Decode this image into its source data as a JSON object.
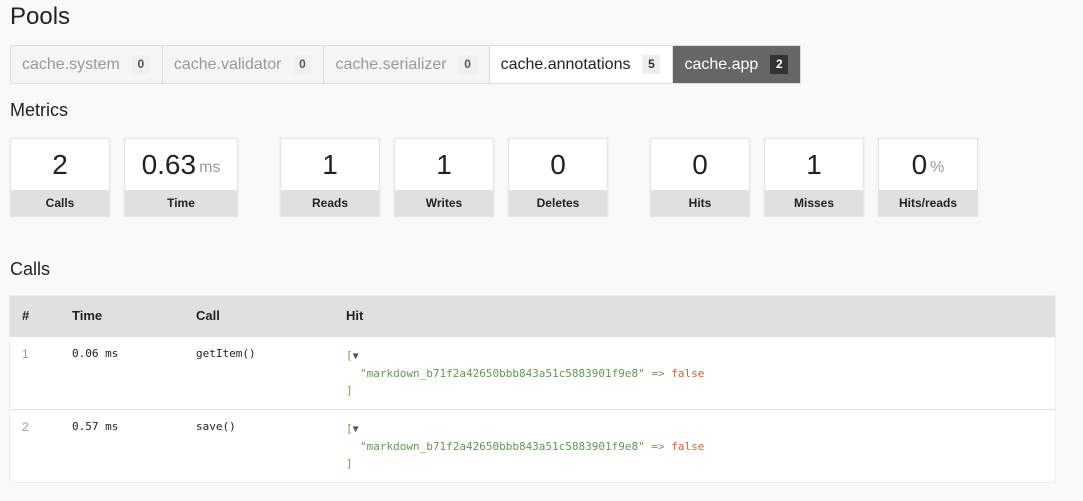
{
  "pools": {
    "title": "Pools",
    "tabs": [
      {
        "label": "cache.system",
        "count": "0",
        "state": "empty"
      },
      {
        "label": "cache.validator",
        "count": "0",
        "state": "empty"
      },
      {
        "label": "cache.serializer",
        "count": "0",
        "state": "empty"
      },
      {
        "label": "cache.annotations",
        "count": "5",
        "state": "has-items"
      },
      {
        "label": "cache.app",
        "count": "2",
        "state": "active"
      }
    ]
  },
  "metrics": {
    "title": "Metrics",
    "items": [
      {
        "value": "2",
        "unit": "",
        "label": "Calls"
      },
      {
        "value": "0.63",
        "unit": "ms",
        "label": "Time"
      },
      {
        "value": "1",
        "unit": "",
        "label": "Reads"
      },
      {
        "value": "1",
        "unit": "",
        "label": "Writes"
      },
      {
        "value": "0",
        "unit": "",
        "label": "Deletes"
      },
      {
        "value": "0",
        "unit": "",
        "label": "Hits"
      },
      {
        "value": "1",
        "unit": "",
        "label": "Misses"
      },
      {
        "value": "0",
        "unit": "%",
        "label": "Hits/reads"
      }
    ]
  },
  "calls": {
    "title": "Calls",
    "headers": {
      "num": "#",
      "time": "Time",
      "call": "Call",
      "hit": "Hit"
    },
    "rows": [
      {
        "num": "1",
        "time": "0.06 ms",
        "call": "getItem()",
        "hit": {
          "open": "[",
          "toggle": "▼",
          "key": "\"markdown_b71f2a42650bbb843a51c5883901f9e8\"",
          "arrow": "=>",
          "value": "false",
          "close": "]"
        }
      },
      {
        "num": "2",
        "time": "0.57 ms",
        "call": "save()",
        "hit": {
          "open": "[",
          "toggle": "▼",
          "key": "\"markdown_b71f2a42650bbb843a51c5883901f9e8\"",
          "arrow": "=>",
          "value": "false",
          "close": "]"
        }
      }
    ]
  }
}
